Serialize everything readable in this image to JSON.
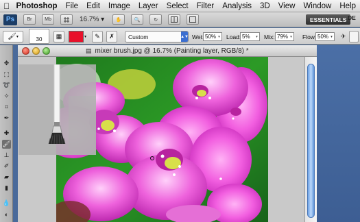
{
  "menubar": {
    "app_name": "Photoshop",
    "items": [
      "File",
      "Edit",
      "Image",
      "Layer",
      "Select",
      "Filter",
      "Analysis",
      "3D",
      "View",
      "Window",
      "Help"
    ]
  },
  "appbar": {
    "logo": "Ps",
    "btn_bridge": "Br",
    "btn_minibridge": "Mb",
    "zoom": "16.7%",
    "workspace": "ESSENTIALS",
    "workspace_next": "DE"
  },
  "options": {
    "brush_size": "30",
    "preset": "Custom",
    "wet_label": "Wet:",
    "wet_value": "50%",
    "load_label": "Load:",
    "load_value": "5%",
    "mix_label": "Mix:",
    "mix_value": "79%",
    "flow_label": "Flow:",
    "flow_value": "50%",
    "load_color": "#e8102a"
  },
  "document": {
    "title": "mixer brush.jpg @ 16.7% (Painting layer, RGB/8) *"
  },
  "tools": [
    "move-icon",
    "marquee-icon",
    "lasso-icon",
    "quick-select-icon",
    "crop-icon",
    "eyedropper-icon",
    "healing-icon",
    "mixer-brush-icon",
    "stamp-icon",
    "history-brush-icon",
    "eraser-icon",
    "gradient-icon",
    "blur-icon",
    "dodge-icon"
  ]
}
